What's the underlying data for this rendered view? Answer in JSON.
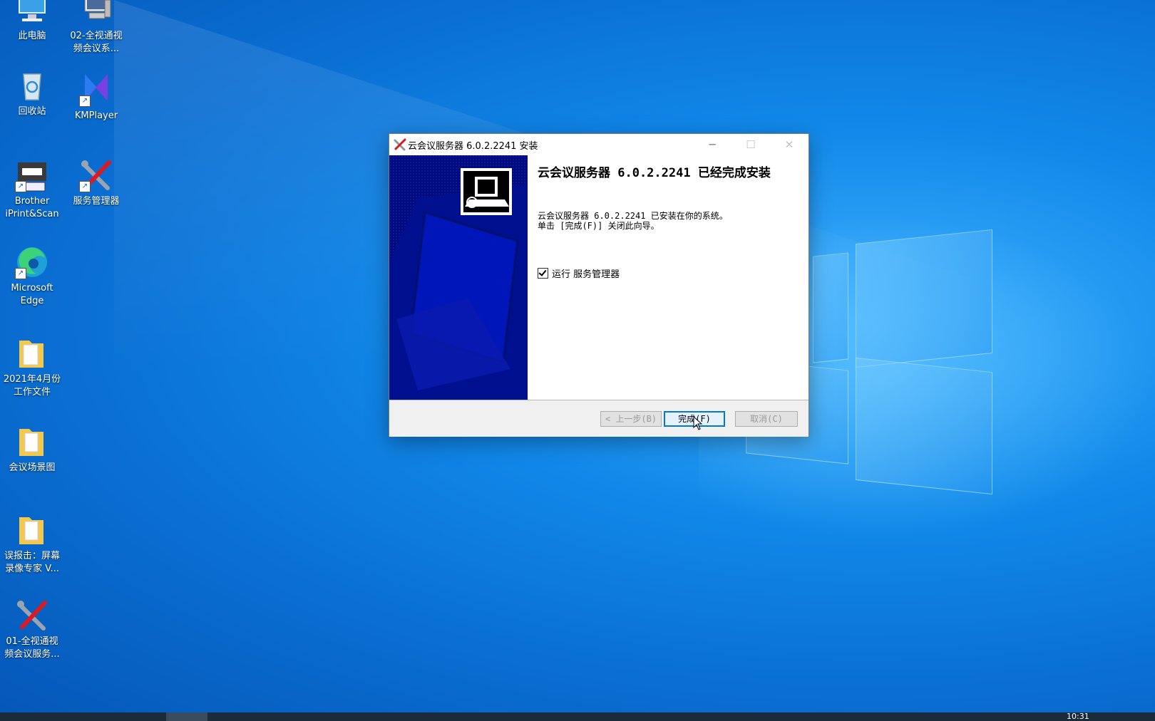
{
  "desktop": {
    "icons": [
      {
        "label": "此电脑"
      },
      {
        "label": "02-全视通视\n频会议系..."
      },
      {
        "label": "回收站"
      },
      {
        "label": "KMPlayer"
      },
      {
        "label": "Brother\niPrint&Scan"
      },
      {
        "label": "服务管理器"
      },
      {
        "label": "Microsoft\nEdge"
      },
      {
        "label": "2021年4月份\n工作文件"
      },
      {
        "label": "会议场景图"
      },
      {
        "label": "误报击：屏幕\n录像专家 V..."
      },
      {
        "label": "01-全视通视\n频会议服务..."
      }
    ]
  },
  "dialog": {
    "title": "云会议服务器 6.0.2.2241 安装",
    "heading": "云会议服务器 6.0.2.2241 已经完成安装",
    "message_line1": "云会议服务器 6.0.2.2241 已安装在你的系统。",
    "message_line2": "单击 [完成(F)] 关闭此向导。",
    "checkbox_label": "运行 服务管理器",
    "checkbox_checked": true,
    "buttons": {
      "back": "< 上一步(B)",
      "finish": "完成(F)",
      "cancel": "取消(C)"
    }
  },
  "taskbar": {
    "clock": "10:31"
  },
  "colors": {
    "sidebar": "#000a78",
    "accent": "#0078d7"
  }
}
